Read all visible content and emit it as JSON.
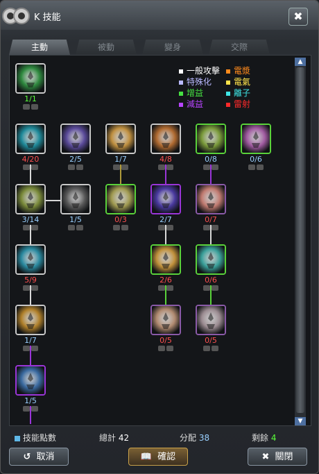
{
  "window": {
    "title": "K 技能",
    "close_label": "✖"
  },
  "tabs": [
    {
      "label": "主動",
      "active": true
    },
    {
      "label": "被動",
      "active": false
    },
    {
      "label": "變身",
      "active": false
    },
    {
      "label": "交際",
      "active": false
    }
  ],
  "legend": [
    {
      "label": "一般攻擊",
      "color": "#ffffff"
    },
    {
      "label": "電漿",
      "color": "#ff8a1c"
    },
    {
      "label": "特殊化",
      "color": "#b9b9ff"
    },
    {
      "label": "電氣",
      "color": "#ffe34a"
    },
    {
      "label": "增益",
      "color": "#46e042"
    },
    {
      "label": "離子",
      "color": "#3fe6e6"
    },
    {
      "label": "減益",
      "color": "#b845ff"
    },
    {
      "label": "雷射",
      "color": "#ff2a2a"
    }
  ],
  "skills": [
    {
      "level": "1/1",
      "frame": "white",
      "art": "#2f8a3f",
      "lv_color": "#5aff3a"
    },
    {
      "level": "4/20",
      "frame": "white",
      "art": "#1f8a9a",
      "lv_color": "#ff5050"
    },
    {
      "level": "3/14",
      "frame": "white",
      "art": "#7a8a3a",
      "lv_color": "#9ad0ff"
    },
    {
      "level": "5/9",
      "frame": "white",
      "art": "#2a8aa0",
      "lv_color": "#ff5050"
    },
    {
      "level": "1/7",
      "frame": "white",
      "art": "#b0802a",
      "lv_color": "#9ad0ff"
    },
    {
      "level": "1/5",
      "frame": "purple",
      "art": "#3a6aa0",
      "lv_color": "#9ad0ff"
    },
    {
      "level": "2/5",
      "frame": "white",
      "art": "#5a4a9a",
      "lv_color": "#9ad0ff"
    },
    {
      "level": "1/5",
      "frame": "white",
      "art": "#5a5a5a",
      "lv_color": "#9ad0ff"
    },
    {
      "level": "1/7",
      "frame": "white",
      "art": "#c09040",
      "lv_color": "#9ad0ff"
    },
    {
      "level": "0/3",
      "frame": "green",
      "art": "#a09a50",
      "lv_color": "#ff5050"
    },
    {
      "level": "4/8",
      "frame": "white",
      "art": "#b06a30",
      "lv_color": "#ff5050"
    },
    {
      "level": "2/7",
      "frame": "purple",
      "art": "#4a3aa0",
      "lv_color": "#9ad0ff"
    },
    {
      "level": "2/6",
      "frame": "green",
      "art": "#c0903a",
      "lv_color": "#ff5050"
    },
    {
      "level": "0/5",
      "frame": "lavender",
      "art": "#b08a70",
      "lv_color": "#ff5050"
    },
    {
      "level": "0/8",
      "frame": "green",
      "art": "#7a9a3a",
      "lv_color": "#9ad0ff"
    },
    {
      "level": "0/7",
      "frame": "lavender",
      "art": "#c07a70",
      "lv_color": "#ff5050"
    },
    {
      "level": "0/6",
      "frame": "green",
      "art": "#3aa09a",
      "lv_color": "#ff5050"
    },
    {
      "level": "0/5",
      "frame": "lavender",
      "art": "#9a8a90",
      "lv_color": "#ff5050"
    },
    {
      "level": "0/6",
      "frame": "green",
      "art": "#a05aa0",
      "lv_color": "#9ad0ff"
    }
  ],
  "footer": {
    "points_label": "技能點數",
    "total_label": "總計",
    "total_value": "42",
    "assigned_label": "分配",
    "assigned_value": "38",
    "remaining_label": "剩餘",
    "remaining_value": "4"
  },
  "buttons": {
    "cancel": "取消",
    "confirm": "確認",
    "close": "關閉"
  },
  "icons": {
    "cancel": "undo-arrow-icon",
    "confirm": "book-icon",
    "close": "close-x-icon"
  }
}
